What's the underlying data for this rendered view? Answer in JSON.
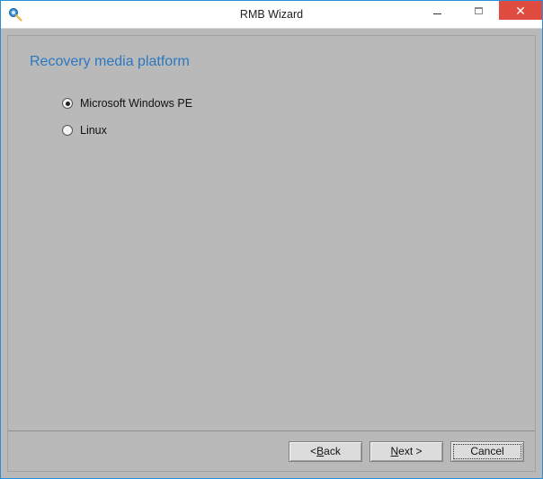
{
  "window": {
    "title": "RMB Wizard"
  },
  "page": {
    "heading": "Recovery media platform"
  },
  "options": [
    {
      "label": "Microsoft Windows PE",
      "selected": true
    },
    {
      "label": "Linux",
      "selected": false
    }
  ],
  "buttons": {
    "back": {
      "prefix": "< ",
      "mnemonic": "B",
      "rest": "ack"
    },
    "next": {
      "mnemonic": "N",
      "rest": "ext >"
    },
    "cancel": {
      "full": "Cancel"
    }
  }
}
